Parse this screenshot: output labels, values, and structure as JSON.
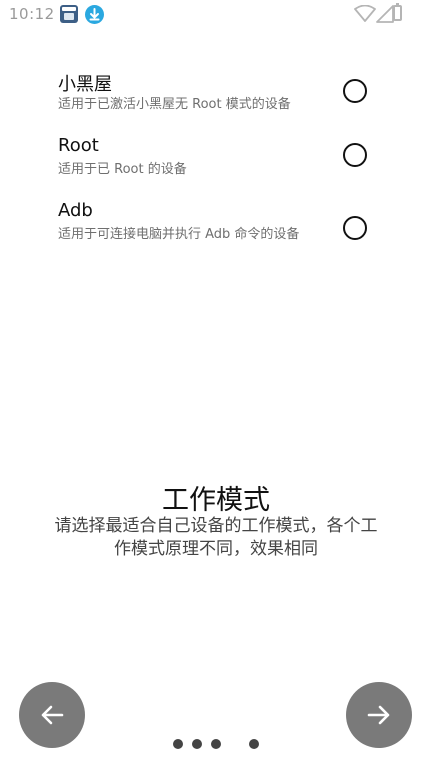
{
  "status_bar": {
    "time": "10:12",
    "icons": [
      "app-notification-icon",
      "download-icon",
      "wifi-icon",
      "signal-icon",
      "battery-icon"
    ]
  },
  "options": [
    {
      "title": "小黑屋",
      "description": "适用于已激活小黑屋无 Root 模式的设备",
      "selected": false
    },
    {
      "title": "Root",
      "description": "适用于已 Root 的设备",
      "selected": false
    },
    {
      "title": "Adb",
      "description": "适用于可连接电脑并执行 Adb 命令的设备",
      "selected": false
    }
  ],
  "page": {
    "title": "工作模式",
    "subtitle": "请选择最适合自己设备的工作模式，各个工作模式原理不同，效果相同"
  },
  "navigation": {
    "back_icon": "arrow-left-icon",
    "next_icon": "arrow-right-icon",
    "page_count": 4,
    "current_page": 4
  },
  "colors": {
    "nav_button": "#7a7a7a",
    "dot": "#444444"
  }
}
